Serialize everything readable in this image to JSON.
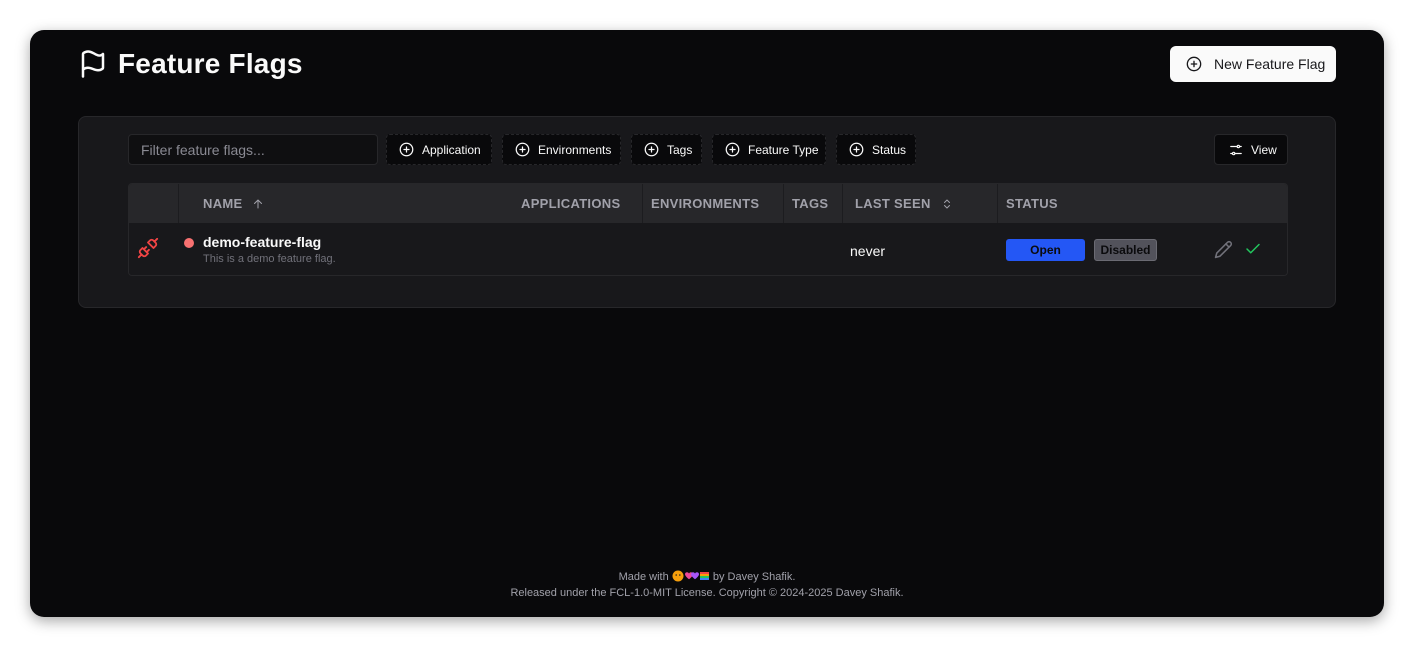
{
  "header": {
    "title": "Feature Flags",
    "new_button_label": "New Feature Flag"
  },
  "filters": {
    "search_placeholder": "Filter feature flags...",
    "chips": [
      "Application",
      "Environments",
      "Tags",
      "Feature Type",
      "Status"
    ],
    "view_label": "View"
  },
  "table": {
    "columns": {
      "name": "NAME",
      "applications": "APPLICATIONS",
      "environments": "ENVIRONMENTS",
      "tags": "TAGS",
      "last_seen": "LAST SEEN",
      "status": "STATUS"
    },
    "sort": {
      "column": "name",
      "direction": "ascending"
    },
    "rows": [
      {
        "name": "demo-feature-flag",
        "description": "This is a demo feature flag.",
        "last_seen": "never",
        "status_open": "Open",
        "status_disabled": "Disabled",
        "indicator_color": "#f87171",
        "icon": "unplugged-icon"
      }
    ]
  },
  "footer": {
    "made_with_prefix": "Made with",
    "made_with_suffix": "by Davey Shafik.",
    "license": "Released under the FCL-1.0-MIT License. Copyright © 2024-2025 Davey Shafik."
  },
  "colors": {
    "background": "#09090b",
    "panel": "#18181b",
    "accent_blue": "#2457f5",
    "status_red": "#f87171",
    "check_green": "#22c55e"
  }
}
